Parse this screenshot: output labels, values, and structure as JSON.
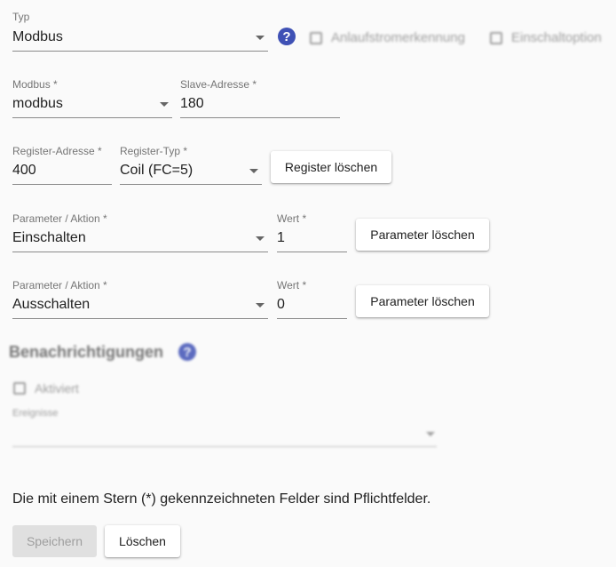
{
  "typ": {
    "label": "Typ",
    "value": "Modbus",
    "help": "?"
  },
  "options": {
    "anlaufstrom": "Anlaufstromerkennung",
    "einschaltoption": "Einschaltoption"
  },
  "modbus": {
    "protocol": {
      "label": "Modbus *",
      "value": "modbus"
    },
    "slave": {
      "label": "Slave-Adresse *",
      "value": "180"
    }
  },
  "register": {
    "address": {
      "label": "Register-Adresse *",
      "value": "400"
    },
    "type": {
      "label": "Register-Typ *",
      "value": "Coil (FC=5)"
    },
    "delete_label": "Register löschen"
  },
  "parameters": [
    {
      "action_label": "Parameter / Aktion *",
      "action_value": "Einschalten",
      "value_label": "Wert *",
      "value": "1",
      "delete_label": "Parameter löschen"
    },
    {
      "action_label": "Parameter / Aktion *",
      "action_value": "Ausschalten",
      "value_label": "Wert *",
      "value": "0",
      "delete_label": "Parameter löschen"
    }
  ],
  "notifications": {
    "heading": "Benachrichtigungen",
    "help": "?",
    "activated_label": "Aktiviert",
    "events_label": "Ereignisse"
  },
  "footer": {
    "required_note": "Die mit einem Stern (*) gekennzeichneten Felder sind Pflichtfelder.",
    "save_label": "Speichern",
    "delete_label": "Löschen"
  }
}
